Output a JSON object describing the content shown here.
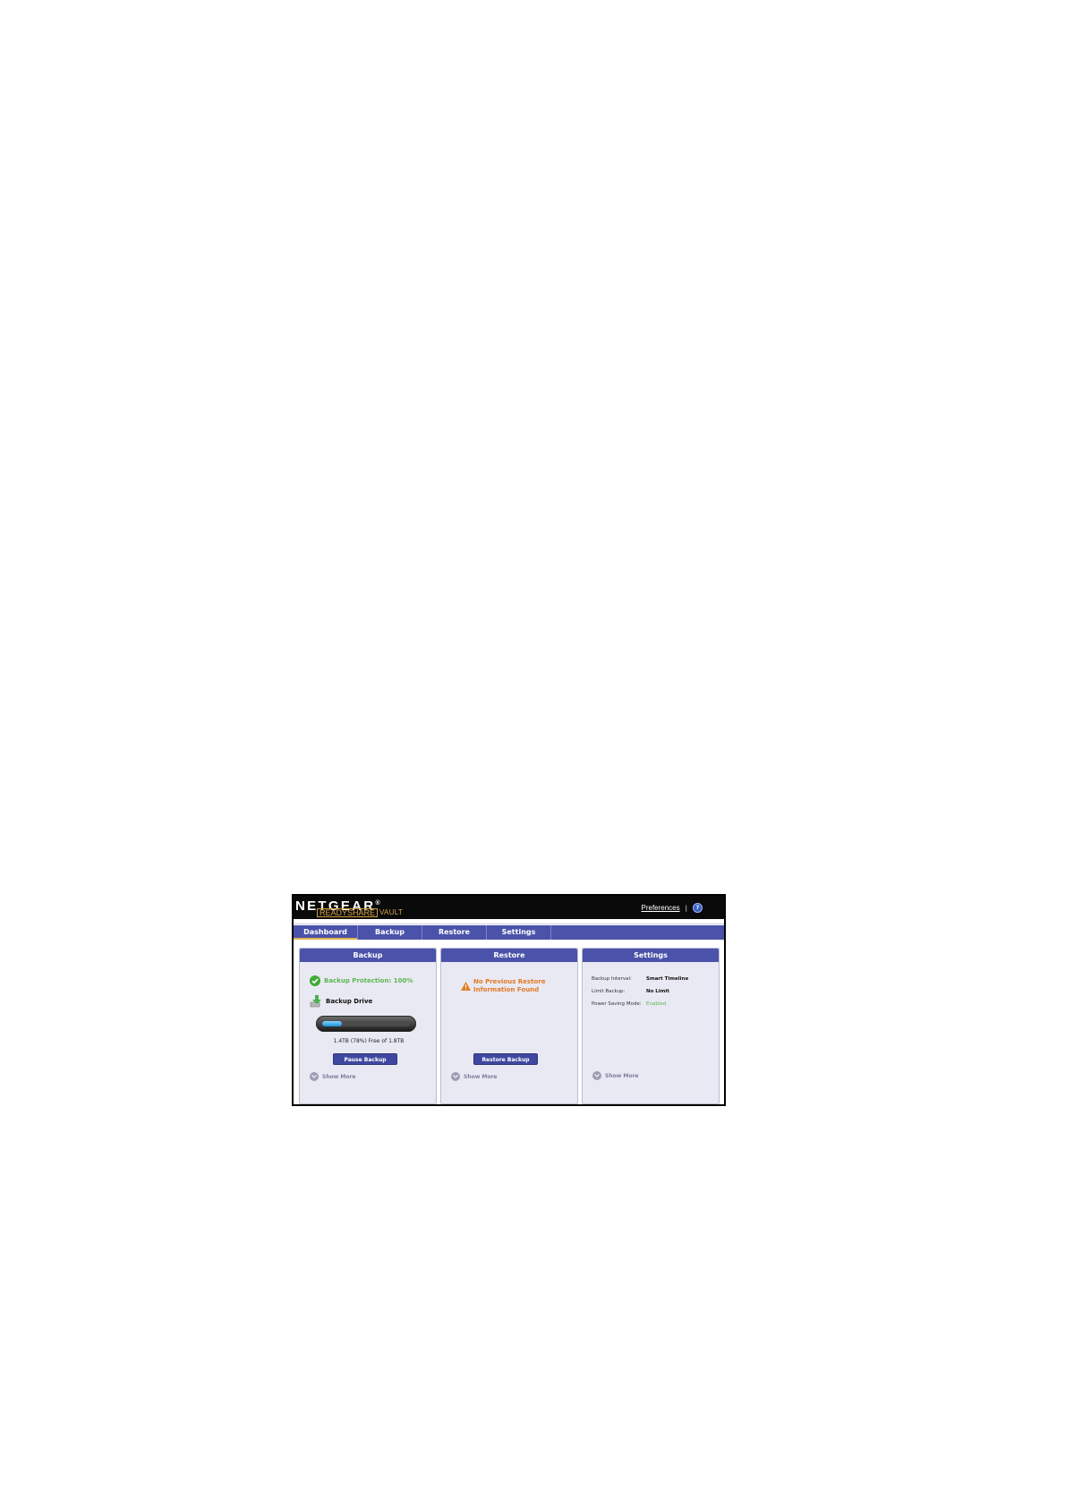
{
  "header": {
    "brand": "NETGEAR",
    "brand_mark": "®",
    "subbrand_box": "READYSHARE",
    "subbrand_tail": "VAULT",
    "preferences_label": "Preferences",
    "separator": "|",
    "help_label": "?"
  },
  "nav": {
    "tabs": [
      {
        "label": "Dashboard",
        "active": true
      },
      {
        "label": "Backup",
        "active": false
      },
      {
        "label": "Restore",
        "active": false
      },
      {
        "label": "Settings",
        "active": false
      }
    ]
  },
  "backup_panel": {
    "title": "Backup",
    "protection_text": "Backup Protection: 100%",
    "drive_label": "Backup Drive",
    "capacity_text": "1.4TB (78%) Free of 1.8TB",
    "used_fraction": 0.22,
    "button_label": "Pause Backup",
    "show_more": "Show More"
  },
  "restore_panel": {
    "title": "Restore",
    "message_line1": "No Previous Restore",
    "message_line2": "Information Found",
    "button_label": "Restore Backup",
    "show_more": "Show More"
  },
  "settings_panel": {
    "title": "Settings",
    "rows": [
      {
        "label": "Backup Interval:",
        "value": "Smart Timeline"
      },
      {
        "label": "Limit Backup:",
        "value": "No Limit"
      },
      {
        "label": "Power Saving Mode:",
        "value": "Enabled"
      }
    ],
    "show_more": "Show More"
  },
  "colors": {
    "accent": "#4b52a9",
    "success": "#5cb84e",
    "warning": "#e17a24",
    "header_bg": "#0a0a0a"
  },
  "icons": {
    "protection": "check-circle-icon",
    "drive": "download-drive-icon",
    "warning": "warning-triangle-icon",
    "show_more": "chevron-down-circle-icon",
    "help": "help-icon"
  }
}
